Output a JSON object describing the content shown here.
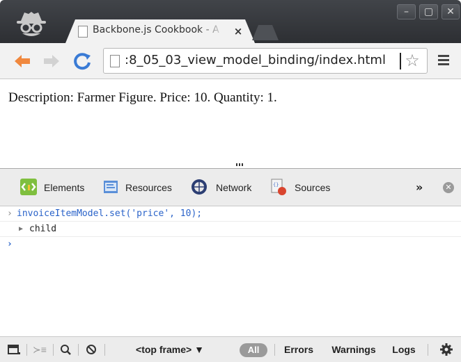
{
  "browser": {
    "tab_title": "Backbone.js Cookbook - A",
    "tab_close": "×",
    "url": ":8_05_03_view_model_binding/index.html",
    "window_buttons": [
      "–",
      "▢",
      "✕"
    ]
  },
  "toolbar_icons": {
    "back": "arrow-left-icon",
    "forward": "arrow-right-icon",
    "reload": "reload-icon",
    "bookmark": "star-icon",
    "menu": "hamburger-menu-icon"
  },
  "page": {
    "content_text": "Description: Farmer Figure. Price: 10. Quantity: 1."
  },
  "devtools": {
    "tabs": [
      {
        "label": "Elements",
        "icon": "elements-icon"
      },
      {
        "label": "Resources",
        "icon": "resources-icon"
      },
      {
        "label": "Network",
        "icon": "network-icon"
      },
      {
        "label": "Sources",
        "icon": "sources-icon"
      }
    ],
    "more": "»",
    "console": {
      "command": "invoiceItemModel.set('price', 10);",
      "result": "child",
      "prompt": "›"
    },
    "statusbar": {
      "frame_selector": "<top frame> ▼",
      "filter_all": "All",
      "filter_errors": "Errors",
      "filter_warnings": "Warnings",
      "filter_logs": "Logs"
    }
  },
  "colors": {
    "titlebar": "#3a3d42",
    "back_arrow": "#f0883e",
    "reload": "#3a7bd5",
    "console_command": "#2a63c9"
  }
}
